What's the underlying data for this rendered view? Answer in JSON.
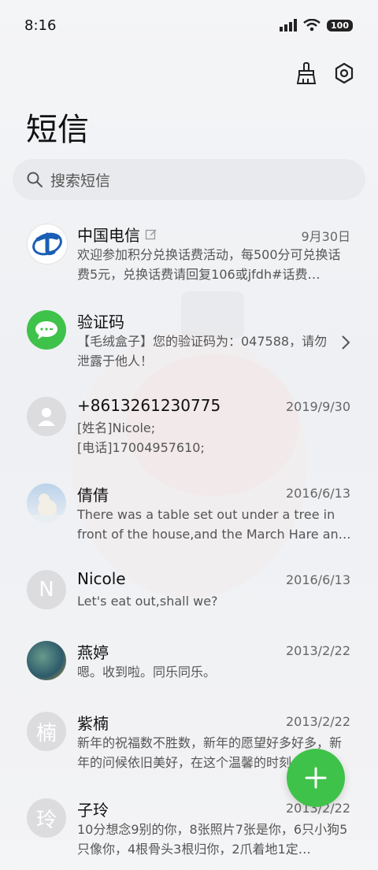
{
  "status_bar": {
    "time": "8:16",
    "battery": "100"
  },
  "header": {
    "title": "短信",
    "icons": [
      "brush-icon",
      "settings-icon"
    ]
  },
  "search": {
    "placeholder": "搜索短信"
  },
  "conversations": [
    {
      "name": "中国电信",
      "date": "9月30日",
      "preview": "欢迎参加积分兑换话费活动，每500分可兑换话费5元，兑换话费请回复106或jfdh#话费…",
      "avatar": "china-telecom-logo",
      "edit_icon": true
    },
    {
      "name": "验证码",
      "date": "",
      "preview": "【毛绒盒子】您的验证码为：047588，请勿泄露于他人！",
      "avatar": "message-icon"
    },
    {
      "name": "+8613261230775",
      "date": "2019/9/30",
      "preview": "[姓名]Nicole;\n[电话]17004957610;",
      "avatar": "person-icon"
    },
    {
      "name": "倩倩",
      "date": "2016/6/13",
      "preview": "There was a table set out under a tree in front of the house,and the March Hare an…",
      "avatar": "polar-bear-photo"
    },
    {
      "name": "Nicole",
      "date": "2016/6/13",
      "preview": "Let's eat out,shall we?",
      "avatar_letter": "N"
    },
    {
      "name": "燕婷",
      "date": "2013/2/22",
      "preview": "嗯。收到啦。同乐同乐。",
      "avatar": "landscape-photo"
    },
    {
      "name": "紫楠",
      "date": "2013/2/22",
      "preview": "新年的祝福数不胜数，新年的愿望好多好多，新年的问候依旧美好，在这个温馨的时刻…",
      "avatar_letter": "楠"
    },
    {
      "name": "子玲",
      "date": "2013/2/22",
      "preview": "10分想念9别的你，8张照片7张是你，6只小狗5只像你，4根骨头3根归你，2爪着地1定…",
      "avatar_letter": "玲"
    }
  ],
  "fab": {
    "icon": "plus-icon"
  },
  "colors": {
    "accent": "#3fc24a",
    "telecom_blue": "#1a5fb4"
  }
}
